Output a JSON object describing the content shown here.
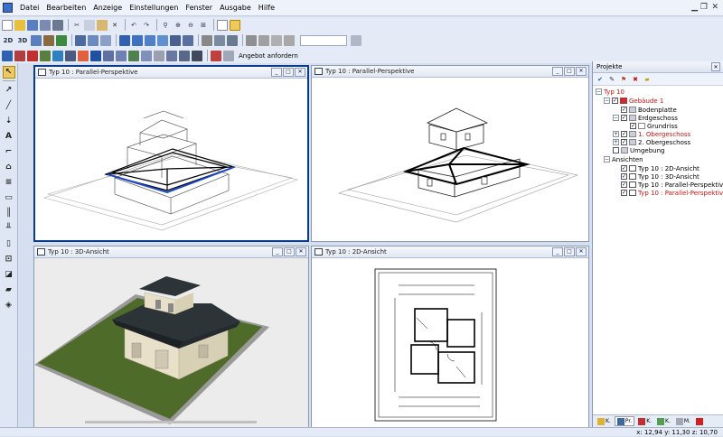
{
  "menu": [
    "Datei",
    "Bearbeiten",
    "Anzeige",
    "Einstellungen",
    "Fenster",
    "Ausgabe",
    "Hilfe"
  ],
  "toolbar": {
    "angebot_label": "Angebot anfordern",
    "btn_2d": "2D",
    "btn_3d": "3D"
  },
  "viewports": [
    {
      "title": "Typ 10 : Parallel-Perspektive"
    },
    {
      "title": "Typ 10 : Parallel-Perspektive"
    },
    {
      "title": "Typ 10 : 3D-Ansicht"
    },
    {
      "title": "Typ 10 : 2D-Ansicht"
    }
  ],
  "panel": {
    "title": "Projekte",
    "tree": [
      {
        "label": "Typ 10",
        "red": true
      },
      {
        "label": "Gebäude 1",
        "red": true
      },
      {
        "label": "Bodenplatte",
        "red": false
      },
      {
        "label": "Erdgeschoss",
        "red": false
      },
      {
        "label": "Grundriss",
        "red": false
      },
      {
        "label": "1. Obergeschoss",
        "red": true
      },
      {
        "label": "2. Obergeschoss",
        "red": false
      },
      {
        "label": "Umgebung",
        "red": false
      },
      {
        "label": "Ansichten",
        "red": false
      },
      {
        "label": "Typ 10 : 2D-Ansicht",
        "red": false
      },
      {
        "label": "Typ 10 : 3D-Ansicht",
        "red": false
      },
      {
        "label": "Typ 10 : Parallel-Perspektiv",
        "red": false
      },
      {
        "label": "Typ 10 : Parallel-Perspektiv",
        "red": true
      }
    ],
    "tabs": [
      "K.",
      "Pr.",
      "K.",
      "K.",
      "M."
    ]
  },
  "status": {
    "coords": "x: 12,94 y: 11,30 z: 10,70"
  },
  "colors": {
    "accent": "#0a3a8a",
    "grass": "#4e6b2a",
    "roof": "#2c3438",
    "wall": "#e8e0c8"
  }
}
